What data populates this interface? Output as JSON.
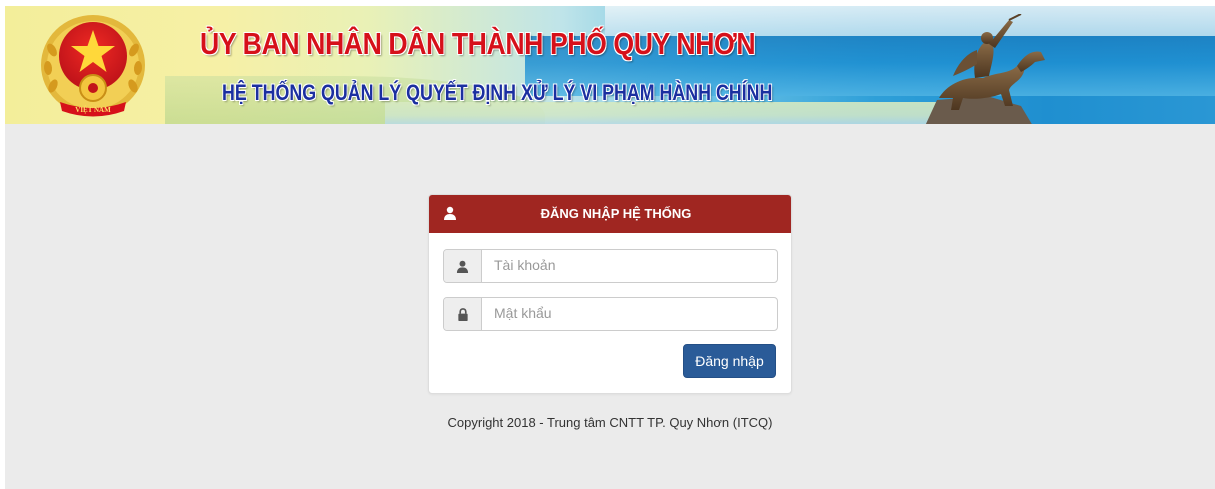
{
  "banner": {
    "title_line_1": "ỦY BAN NHÂN DÂN THÀNH PHỐ QUY NHƠN",
    "title_line_2": "HỆ THỐNG QUẢN LÝ QUYẾT ĐỊNH XỬ LÝ VI PHẠM HÀNH CHÍNH",
    "emblem_ribbon_text": "VIỆT NAM",
    "colors": {
      "title_line_1": "#d6101a",
      "title_line_2": "#1b2fa0"
    }
  },
  "login": {
    "heading": "ĐĂNG NHẬP HỆ THỐNG",
    "heading_icon": "user-icon",
    "username": {
      "icon": "user-icon",
      "placeholder": "Tài khoản",
      "value": ""
    },
    "password": {
      "icon": "lock-icon",
      "placeholder": "Mật khẩu",
      "value": ""
    },
    "submit_label": "Đăng nhập",
    "colors": {
      "heading_bg": "#a02621",
      "button_bg": "#2a5b98"
    }
  },
  "footer": {
    "copyright": "Copyright 2018 - Trung tâm CNTT TP. Quy Nhơn (ITCQ)"
  }
}
